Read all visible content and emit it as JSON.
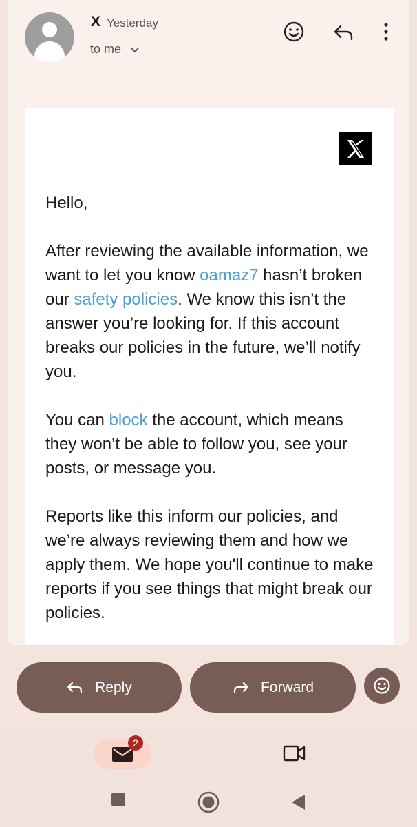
{
  "header": {
    "sender": "X",
    "time": "Yesterday",
    "recipient_label": "to me"
  },
  "email": {
    "greeting": "Hello,",
    "p1": {
      "part1": "After reviewing the available information, we want to let you know ",
      "account_link": "oamaz7",
      "part2": " hasn’t broken our ",
      "policy_link": "safety policies",
      "part3": ". We know this isn’t the answer you’re looking for. If this account breaks our policies in the future, we’ll notify you."
    },
    "p2": {
      "part1": "You can ",
      "block_link": "block",
      "part2": " the account, which means they won’t be able to follow you, see your posts, or message you."
    },
    "p3": "Reports like this inform our policies, and we’re always reviewing them and how we apply them. We hope you'll continue to make reports if you see things that might break our policies."
  },
  "actions": {
    "reply_label": "Reply",
    "forward_label": "Forward"
  },
  "nav": {
    "mail_badge": "2"
  },
  "colors": {
    "accent_button": "#785d57",
    "link": "#4a9ed4",
    "badge": "#b3261e",
    "mail_pill": "#fbd5cb"
  },
  "icons": [
    "smiley-icon",
    "reply-icon",
    "more-vert-icon",
    "chevron-down-icon",
    "x-logo-icon",
    "forward-icon",
    "add-reaction-icon",
    "mail-icon",
    "video-icon",
    "home-square-icon",
    "circle-icon",
    "back-triangle-icon"
  ]
}
